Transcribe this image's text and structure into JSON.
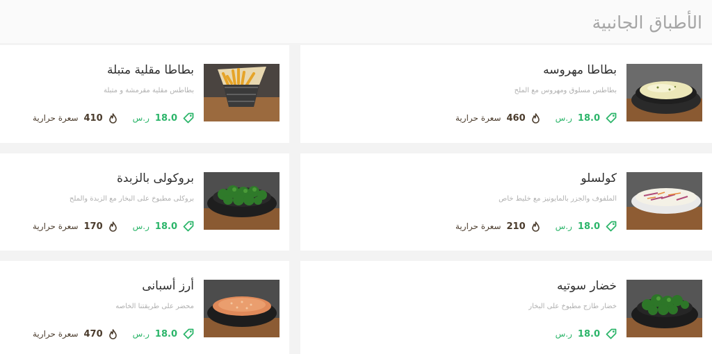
{
  "section": {
    "title": "الأطباق الجانبية"
  },
  "colors": {
    "accent": "#2cb56a",
    "calories": "#4a3b2c",
    "title": "#a5a5a5"
  },
  "items": [
    {
      "name": "بطاطا مهروسه",
      "description": "بطاطس مسلوق ومهروس مع الملح",
      "price": "18.0",
      "currency": "ر.س",
      "calories": "460",
      "calories_label": "سعرة حرارية",
      "image": "mashed-potatoes"
    },
    {
      "name": "بطاطا مقلية متبلة",
      "description": "بطاطس مقلية مقرمشة و متبلة",
      "price": "18.0",
      "currency": "ر.س",
      "calories": "410",
      "calories_label": "سعرة حرارية",
      "image": "fries"
    },
    {
      "name": "كولسلو",
      "description": "الملفوف والجزر بالمايونيز مع خليط خاص",
      "price": "18.0",
      "currency": "ر.س",
      "calories": "210",
      "calories_label": "سعرة حرارية",
      "image": "coleslaw"
    },
    {
      "name": "بروكولى بالزبدة",
      "description": "بروكلى مطبوخ على البخار مع الزبدة والملح",
      "price": "18.0",
      "currency": "ر.س",
      "calories": "170",
      "calories_label": "سعرة حرارية",
      "image": "broccoli"
    },
    {
      "name": "خضار سوتيه",
      "description": "خضار طازج مطبوخ على البخار",
      "price": "18.0",
      "currency": "ر.س",
      "image": "sauteed-vegetables"
    },
    {
      "name": "أرز أسبانى",
      "description": "محضر على طريقتنا الخاصه",
      "price": "18.0",
      "currency": "ر.س",
      "calories": "470",
      "calories_label": "سعرة حرارية",
      "image": "spanish-rice"
    }
  ]
}
